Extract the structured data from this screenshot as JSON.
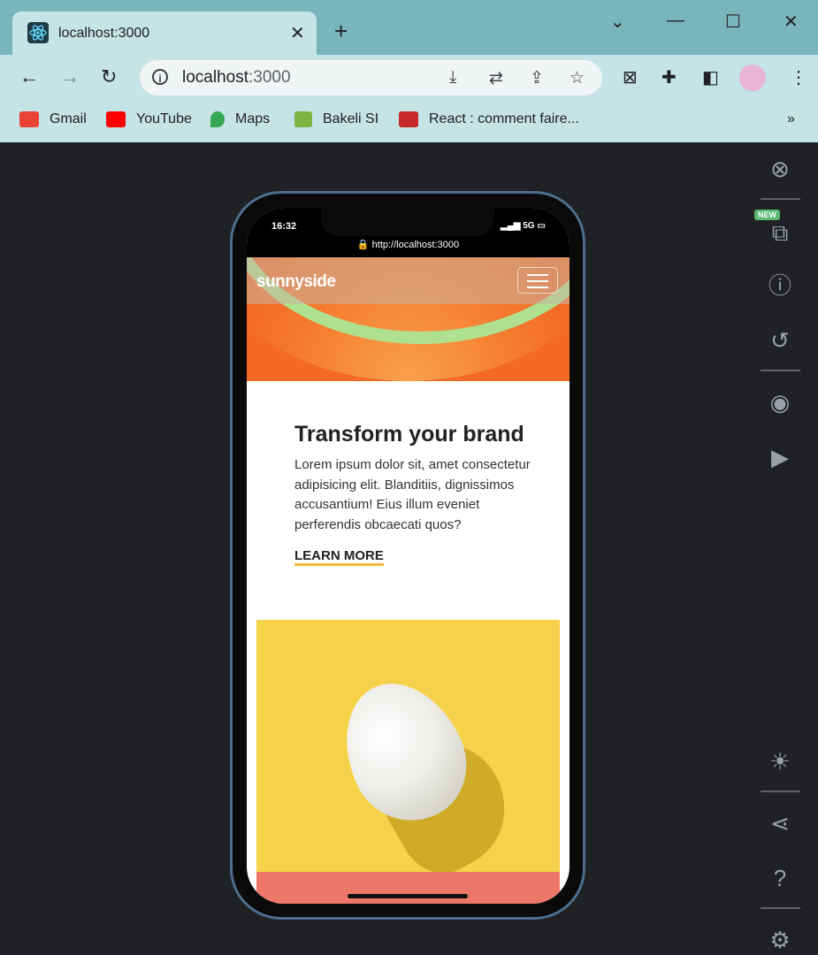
{
  "browser": {
    "tab_title": "localhost:3000",
    "new_tab": "+",
    "window_controls": {
      "dropdown": "⌄",
      "minimize": "—",
      "maximize": "☐",
      "close": "✕"
    },
    "url_host": "localhost",
    "url_port": ":3000",
    "bookmarks": [
      {
        "label": "Gmail",
        "icon": "gmail-icon",
        "color": "#ea4335"
      },
      {
        "label": "YouTube",
        "icon": "youtube-icon",
        "color": "#ff0000"
      },
      {
        "label": "Maps",
        "icon": "maps-icon",
        "color": "#34a853"
      },
      {
        "label": "Bakeli SI",
        "icon": "bakeli-icon",
        "color": "#7cb342"
      },
      {
        "label": "React : comment faire...",
        "icon": "j-icon",
        "color": "#c62828"
      }
    ],
    "bookmarks_overflow": "»"
  },
  "device_tools": {
    "new_badge": "NEW"
  },
  "phone": {
    "time": "16:32",
    "network": "5G",
    "address": "http://localhost:3000"
  },
  "site": {
    "logo": "sunnyside",
    "heading": "Transform your brand",
    "body": "Lorem ipsum dolor sit, amet consectetur adipisicing elit. Blanditiis, dignissimos accusantium! Eius illum eveniet perferendis obcaecati quos?",
    "cta": "LEARN MORE",
    "colors": {
      "accent": "#f5b63b",
      "egg_bg": "#f6d24a",
      "coral": "#ed786a"
    }
  }
}
